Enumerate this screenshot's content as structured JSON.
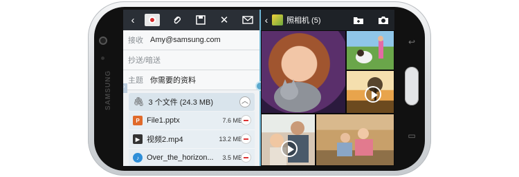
{
  "device": {
    "brand": "SAMSUNG"
  },
  "email": {
    "to_label": "接收",
    "to_value": "Amy@samsung.com",
    "cc_label": "抄送/暗送",
    "subject_label": "主题",
    "subject_value": "你需要的资料",
    "attachments_summary": "3 个文件 (24.3 MB)",
    "files": [
      {
        "name": "File1.pptx",
        "size": "7.6 MB",
        "icon": "pptx-icon"
      },
      {
        "name": "视频2.mp4",
        "size": "13.2 MB",
        "icon": "video-icon"
      },
      {
        "name": "Over_the_horizon...",
        "size": "3.5 MB",
        "icon": "audio-icon"
      }
    ]
  },
  "gallery": {
    "title": "照相机 (5)"
  },
  "colors": {
    "toolbar": "#2a2f36",
    "accent": "#5aa8cd",
    "remove": "#dd3333"
  }
}
